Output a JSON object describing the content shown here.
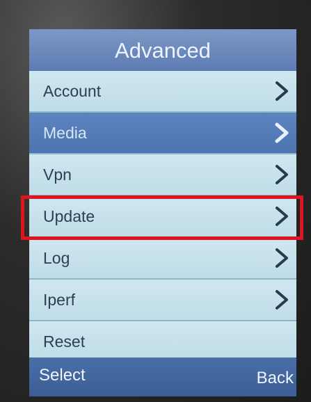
{
  "screen": {
    "title": "Advanced",
    "menu": [
      {
        "label": "Account",
        "icon": "chevron-right-icon",
        "selected": false
      },
      {
        "label": "Media",
        "icon": "chevron-right-icon",
        "selected": true
      },
      {
        "label": "Vpn",
        "icon": "chevron-right-icon",
        "selected": false
      },
      {
        "label": "Update",
        "icon": "chevron-right-icon",
        "selected": false
      },
      {
        "label": "Log",
        "icon": "chevron-right-icon",
        "selected": false
      },
      {
        "label": "Iperf",
        "icon": "chevron-right-icon",
        "selected": false
      },
      {
        "label": "Reset",
        "selected": false
      }
    ],
    "softkeys": {
      "left": "Select",
      "right": "Back"
    }
  },
  "annotation": {
    "highlighted_item": "Update",
    "color": "#e0141e"
  },
  "colors": {
    "title_bar": "#6a88bb",
    "selected_row": "#5478b4",
    "row": "#c7e2ec",
    "softkey_bar": "#4466a0"
  }
}
